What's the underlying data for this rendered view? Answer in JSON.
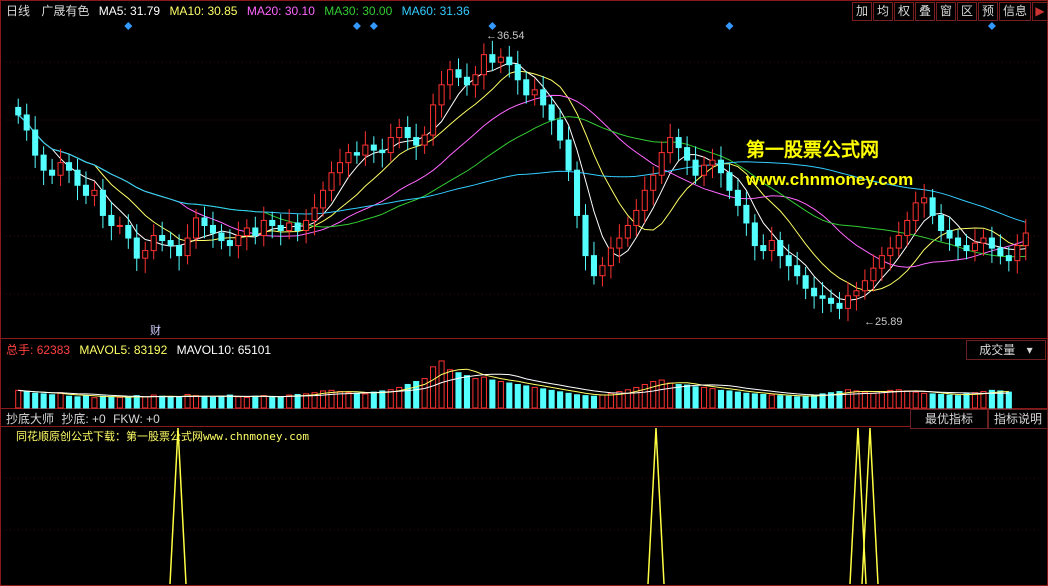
{
  "header": {
    "period": "日线",
    "stock_name": "广晟有色",
    "ma": [
      {
        "label": "MA5: 31.79",
        "color": "#ffffff"
      },
      {
        "label": "MA10: 30.85",
        "color": "#ffff66"
      },
      {
        "label": "MA20: 30.10",
        "color": "#ff66ff"
      },
      {
        "label": "MA30: 30.00",
        "color": "#33cc33"
      },
      {
        "label": "MA60: 31.36",
        "color": "#33ccff"
      }
    ]
  },
  "toolbar": {
    "buttons": [
      "加",
      "均",
      "权",
      "叠",
      "窗",
      "区",
      "预",
      "信息"
    ],
    "arrow": "▶"
  },
  "annotations": {
    "high_label": "36.54",
    "low_label": "25.89",
    "cai_label": "财"
  },
  "watermark": {
    "line1": "第一股票公式网",
    "line2": "www.chnmoney.com"
  },
  "volume_panel": {
    "total_label": "总手:",
    "total_value": "62383",
    "mavol5": "MAVOL5: 83192",
    "mavol10": "MAVOL10: 65101",
    "button": "成交量"
  },
  "indicator_panel": {
    "name": "抄底大师",
    "value_label": "抄底: +0",
    "fkw_label": "FKW: +0",
    "promo": "同花顺原创公式下载：第一股票公式网www.chnmoney.com",
    "btn_best": "最优指标",
    "btn_desc": "指标说明"
  },
  "colors": {
    "up": "#ff3232",
    "down": "#54ffff",
    "border": "#8a1a1a",
    "signal": "#ffff44"
  },
  "chart_data": {
    "type": "candlestick",
    "price_range": [
      25.0,
      37.5
    ],
    "high_marker": {
      "value": 36.54
    },
    "low_marker": {
      "value": 25.89
    },
    "closes": [
      33.8,
      33.2,
      32.2,
      31.6,
      31.4,
      31.9,
      31.6,
      31.0,
      30.6,
      30.8,
      29.8,
      29.4,
      29.4,
      28.9,
      28.1,
      28.4,
      29.0,
      28.8,
      28.6,
      28.2,
      28.9,
      29.7,
      29.4,
      29.1,
      28.8,
      28.6,
      29.0,
      29.3,
      29.0,
      29.6,
      29.4,
      29.2,
      29.5,
      29.2,
      29.6,
      30.1,
      30.8,
      31.5,
      31.9,
      32.3,
      32.2,
      32.6,
      32.4,
      32.3,
      32.9,
      33.3,
      32.9,
      32.6,
      33.0,
      34.2,
      35.0,
      35.6,
      35.3,
      35.0,
      35.4,
      36.2,
      35.9,
      36.1,
      35.8,
      35.2,
      34.6,
      34.8,
      34.2,
      33.6,
      32.8,
      31.6,
      29.8,
      28.2,
      27.4,
      27.8,
      28.5,
      28.9,
      29.4,
      30.0,
      30.8,
      31.4,
      32.3,
      32.9,
      32.5,
      32.0,
      31.4,
      31.8,
      32.0,
      31.5,
      30.8,
      30.2,
      29.5,
      28.6,
      28.4,
      28.8,
      28.2,
      27.8,
      27.4,
      26.9,
      26.6,
      26.5,
      26.3,
      26.1,
      26.6,
      26.8,
      27.2,
      27.7,
      28.2,
      28.5,
      29.0,
      29.6,
      30.3,
      30.5,
      29.8,
      29.2,
      28.9,
      28.6,
      28.4,
      28.7,
      28.9,
      28.5,
      28.2,
      28.0,
      28.6,
      29.1
    ],
    "ma_series": [
      {
        "name": "MA5",
        "color": "#ffffff"
      },
      {
        "name": "MA10",
        "color": "#ffff66"
      },
      {
        "name": "MA20",
        "color": "#ff66ff"
      },
      {
        "name": "MA30",
        "color": "#33cc33"
      },
      {
        "name": "MA60",
        "color": "#33ccff"
      }
    ],
    "volume": [
      60,
      55,
      50,
      48,
      45,
      52,
      40,
      38,
      42,
      35,
      40,
      38,
      36,
      34,
      42,
      38,
      44,
      40,
      36,
      38,
      46,
      42,
      38,
      36,
      40,
      44,
      38,
      36,
      40,
      42,
      38,
      36,
      44,
      46,
      48,
      52,
      58,
      60,
      56,
      52,
      50,
      48,
      54,
      58,
      62,
      70,
      80,
      90,
      100,
      140,
      160,
      130,
      120,
      110,
      100,
      105,
      95,
      90,
      85,
      80,
      75,
      70,
      65,
      60,
      55,
      50,
      45,
      42,
      40,
      44,
      50,
      56,
      62,
      70,
      80,
      90,
      95,
      85,
      80,
      78,
      72,
      70,
      66,
      60,
      58,
      54,
      50,
      48,
      46,
      44,
      42,
      40,
      38,
      40,
      44,
      48,
      52,
      56,
      62,
      58,
      54,
      50,
      56,
      60,
      62,
      58,
      54,
      50,
      48,
      46,
      44,
      42,
      48,
      52,
      56,
      60,
      58,
      54
    ],
    "mavol5": 83192,
    "mavol10": 65101,
    "signals": [
      {
        "bar": 41,
        "value": 1
      },
      {
        "bar": 153,
        "value": 1
      },
      {
        "bar": 200,
        "value": 1
      },
      {
        "bar": 204,
        "value": 1
      }
    ]
  }
}
